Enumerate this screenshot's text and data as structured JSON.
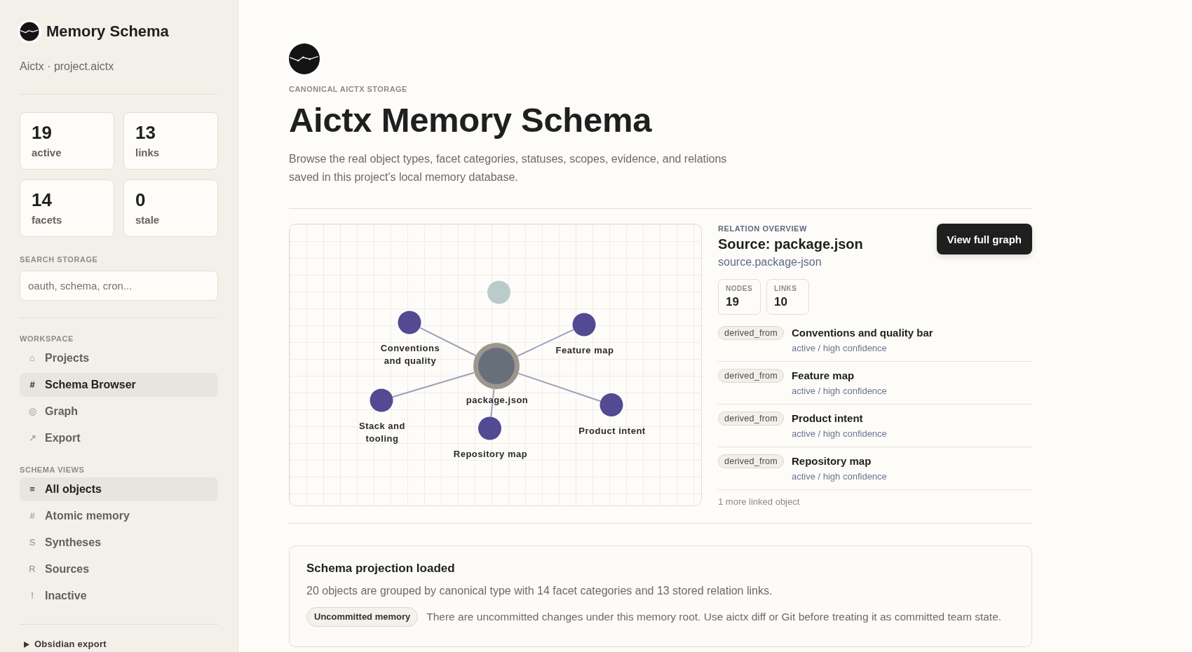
{
  "sidebar": {
    "title": "Memory Schema",
    "subtitle": "Aictx · project.aictx",
    "stats": [
      {
        "value": "19",
        "label": "active"
      },
      {
        "value": "13",
        "label": "links"
      },
      {
        "value": "14",
        "label": "facets"
      },
      {
        "value": "0",
        "label": "stale"
      }
    ],
    "search": {
      "label": "SEARCH STORAGE",
      "placeholder": "oauth, schema, cron..."
    },
    "sections": [
      {
        "heading": "WORKSPACE",
        "items": [
          {
            "glyph": "⌂",
            "label": "Projects",
            "selected": false
          },
          {
            "glyph": "#",
            "label": "Schema Browser",
            "selected": true
          },
          {
            "glyph": "◎",
            "label": "Graph",
            "selected": false
          },
          {
            "glyph": "↗",
            "label": "Export",
            "selected": false
          }
        ]
      },
      {
        "heading": "SCHEMA VIEWS",
        "items": [
          {
            "glyph": "≡",
            "label": "All objects",
            "selected": true
          },
          {
            "glyph": "#",
            "label": "Atomic memory",
            "selected": false
          },
          {
            "glyph": "S",
            "label": "Syntheses",
            "selected": false
          },
          {
            "glyph": "R",
            "label": "Sources",
            "selected": false
          },
          {
            "glyph": "!",
            "label": "Inactive",
            "selected": false
          }
        ]
      }
    ],
    "export": {
      "label": "Obsidian export",
      "expanded": false
    }
  },
  "header": {
    "eyebrow": "CANONICAL AICTX STORAGE",
    "title": "Aictx Memory Schema",
    "description": "Browse the real object types, facet categories, statuses, scopes, evidence, and relations saved in this project's local memory database."
  },
  "graph": {
    "center": {
      "label": "package.json"
    },
    "nodes": [
      {
        "kind": "unlinked"
      },
      {
        "kind": "linked",
        "label": "Conventions and quality"
      },
      {
        "kind": "linked",
        "label": "Feature map"
      },
      {
        "kind": "linked",
        "label": "Stack and tooling"
      },
      {
        "kind": "linked",
        "label": "Repository map"
      },
      {
        "kind": "linked",
        "label": "Product intent"
      }
    ]
  },
  "overview": {
    "eyebrow": "RELATION OVERVIEW",
    "title": "Source: package.json",
    "slug": "source.package-json",
    "button": "View full graph",
    "counts": [
      {
        "label": "NODES",
        "value": "19"
      },
      {
        "label": "LINKS",
        "value": "10"
      }
    ],
    "relations": [
      {
        "relation": "derived_from",
        "title": "Conventions and quality bar",
        "meta": "active / high confidence"
      },
      {
        "relation": "derived_from",
        "title": "Feature map",
        "meta": "active / high confidence"
      },
      {
        "relation": "derived_from",
        "title": "Product intent",
        "meta": "active / high confidence"
      },
      {
        "relation": "derived_from",
        "title": "Repository map",
        "meta": "active / high confidence"
      }
    ],
    "more": "1 more linked object"
  },
  "status": {
    "title": "Schema projection loaded",
    "summary": "20 objects are grouped by canonical type with 14 facet categories and 13 stored relation links.",
    "badge": "Uncommitted memory",
    "note": "There are uncommitted changes under this memory root. Use aictx diff or Git before treating it as committed team state."
  }
}
